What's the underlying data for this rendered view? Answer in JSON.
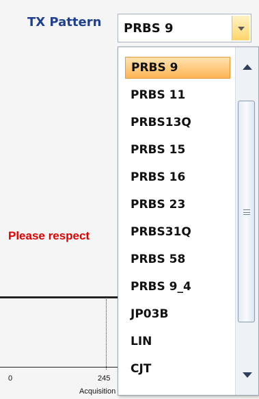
{
  "header": {
    "label": "TX Pattern"
  },
  "combo": {
    "value": "PRBS 9"
  },
  "background": {
    "warning_text": "Please respect",
    "tick_left": "0",
    "tick_mid": "245",
    "axis_label": "Acquisition"
  },
  "dropdown": {
    "selected": "PRBS 9",
    "items": [
      {
        "label": "PRBS 9"
      },
      {
        "label": "PRBS 11"
      },
      {
        "label": "PRBS13Q"
      },
      {
        "label": "PRBS 15"
      },
      {
        "label": "PRBS 16"
      },
      {
        "label": "PRBS 23"
      },
      {
        "label": "PRBS31Q"
      },
      {
        "label": "PRBS 58"
      },
      {
        "label": "PRBS 9_4"
      },
      {
        "label": "JP03B"
      },
      {
        "label": "LIN"
      },
      {
        "label": "CJT"
      }
    ]
  },
  "icons": {
    "combo_arrow": "chevron-down-icon",
    "scroll_up": "scroll-up-arrow-icon",
    "scroll_down": "scroll-down-arrow-icon",
    "thumb_grip": "scroll-grip-icon"
  },
  "colors": {
    "label_blue": "#1f3f8f",
    "warning_red": "#e10000",
    "selection_orange": "#ffb454",
    "combo_button_gold": "#ffd56b"
  }
}
